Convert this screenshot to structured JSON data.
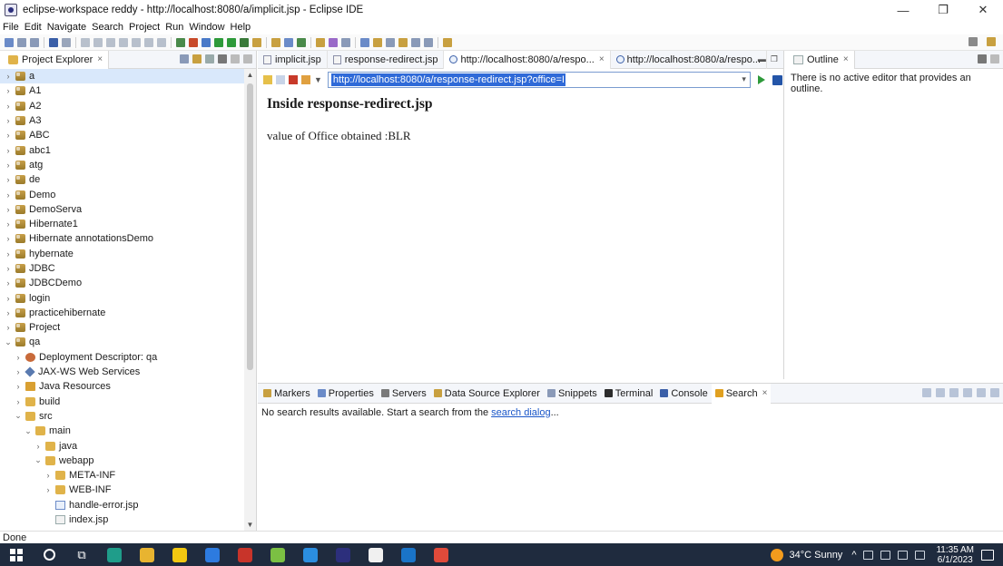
{
  "window": {
    "title": "eclipse-workspace reddy - http://localhost:8080/a/implicit.jsp - Eclipse IDE",
    "minimize": "—",
    "maximize": "❐",
    "close": "✕"
  },
  "menu": [
    "File",
    "Edit",
    "Navigate",
    "Search",
    "Project",
    "Run",
    "Window",
    "Help"
  ],
  "project_explorer": {
    "tab_label": "Project Explorer",
    "tree": [
      {
        "label": "a",
        "depth": 0,
        "expanded": false,
        "icon": "project",
        "selected": true
      },
      {
        "label": "A1",
        "depth": 0,
        "expanded": false,
        "icon": "project"
      },
      {
        "label": "A2",
        "depth": 0,
        "expanded": false,
        "icon": "project"
      },
      {
        "label": "A3",
        "depth": 0,
        "expanded": false,
        "icon": "project"
      },
      {
        "label": "ABC",
        "depth": 0,
        "expanded": false,
        "icon": "project"
      },
      {
        "label": "abc1",
        "depth": 0,
        "expanded": false,
        "icon": "project"
      },
      {
        "label": "atg",
        "depth": 0,
        "expanded": false,
        "icon": "project"
      },
      {
        "label": "de",
        "depth": 0,
        "expanded": false,
        "icon": "project"
      },
      {
        "label": "Demo",
        "depth": 0,
        "expanded": false,
        "icon": "project"
      },
      {
        "label": "DemoServa",
        "depth": 0,
        "expanded": false,
        "icon": "project"
      },
      {
        "label": "Hibernate1",
        "depth": 0,
        "expanded": false,
        "icon": "project"
      },
      {
        "label": "Hibernate annotationsDemo",
        "depth": 0,
        "expanded": false,
        "icon": "project"
      },
      {
        "label": "hybernate",
        "depth": 0,
        "expanded": false,
        "icon": "project"
      },
      {
        "label": "JDBC",
        "depth": 0,
        "expanded": false,
        "icon": "project"
      },
      {
        "label": "JDBCDemo",
        "depth": 0,
        "expanded": false,
        "icon": "project"
      },
      {
        "label": "login",
        "depth": 0,
        "expanded": false,
        "icon": "project"
      },
      {
        "label": "practicehibernate",
        "depth": 0,
        "expanded": false,
        "icon": "project"
      },
      {
        "label": "Project",
        "depth": 0,
        "expanded": false,
        "icon": "project"
      },
      {
        "label": "qa",
        "depth": 0,
        "expanded": true,
        "icon": "project"
      },
      {
        "label": "Deployment Descriptor: qa",
        "depth": 1,
        "expanded": false,
        "icon": "dd"
      },
      {
        "label": "JAX-WS Web Services",
        "depth": 1,
        "expanded": false,
        "icon": "ws"
      },
      {
        "label": "Java Resources",
        "depth": 1,
        "expanded": false,
        "icon": "jr"
      },
      {
        "label": "build",
        "depth": 1,
        "expanded": false,
        "icon": "folder"
      },
      {
        "label": "src",
        "depth": 1,
        "expanded": true,
        "icon": "folder"
      },
      {
        "label": "main",
        "depth": 2,
        "expanded": true,
        "icon": "folder"
      },
      {
        "label": "java",
        "depth": 3,
        "expanded": false,
        "icon": "folder"
      },
      {
        "label": "webapp",
        "depth": 3,
        "expanded": true,
        "icon": "folder"
      },
      {
        "label": "META-INF",
        "depth": 4,
        "expanded": false,
        "icon": "folder"
      },
      {
        "label": "WEB-INF",
        "depth": 4,
        "expanded": false,
        "icon": "folder"
      },
      {
        "label": "handle-error.jsp",
        "depth": 4,
        "expanded": null,
        "icon": "jsp"
      },
      {
        "label": "index.jsp",
        "depth": 4,
        "expanded": null,
        "icon": "file"
      }
    ]
  },
  "editor": {
    "tabs": [
      {
        "label": "implicit.jsp",
        "icon": "file",
        "active": false,
        "closable": false
      },
      {
        "label": "response-redirect.jsp",
        "icon": "file",
        "active": false,
        "closable": false
      },
      {
        "label": "http://localhost:8080/a/respo...",
        "icon": "globe",
        "active": true,
        "closable": true
      },
      {
        "label": "http://localhost:8080/a/respo...",
        "icon": "globe",
        "active": false,
        "closable": false
      }
    ],
    "url": "http://localhost:8080/a/response-redirect.jsp?office=BLR",
    "page_heading": "Inside response-redirect.jsp",
    "page_text": "value of Office obtained :BLR"
  },
  "outline": {
    "tab_label": "Outline",
    "message": "There is no active editor that provides an outline."
  },
  "bottom_panel": {
    "tabs": [
      {
        "label": "Markers",
        "color": "#c8a040"
      },
      {
        "label": "Properties",
        "color": "#6b8bc8"
      },
      {
        "label": "Servers",
        "color": "#7a7a7a"
      },
      {
        "label": "Data Source Explorer",
        "color": "#c8a040"
      },
      {
        "label": "Snippets",
        "color": "#8a9ab8"
      },
      {
        "label": "Terminal",
        "color": "#2c2c2c"
      },
      {
        "label": "Console",
        "color": "#3b5fa8"
      },
      {
        "label": "Search",
        "color": "#e0a020",
        "active": true
      }
    ],
    "message_prefix": "No search results available. Start a search from the ",
    "message_link": "search dialog",
    "message_suffix": "..."
  },
  "status": "Done",
  "taskbar": {
    "weather": "34°C  Sunny",
    "time": "11:35 AM",
    "date": "6/1/2023",
    "apps": [
      {
        "name": "edge-icon",
        "color": "#1f9d8a"
      },
      {
        "name": "file-explorer-icon",
        "color": "#e8b430"
      },
      {
        "name": "power-bi-icon",
        "color": "#f2c811"
      },
      {
        "name": "app-icon-blue",
        "color": "#2d7be0"
      },
      {
        "name": "visual-studio-icon",
        "color": "#c8342a"
      },
      {
        "name": "app-icon-green",
        "color": "#7bc043"
      },
      {
        "name": "app-icon-azure",
        "color": "#2b8ee0"
      },
      {
        "name": "eclipse-icon",
        "color": "#2c2f7c"
      },
      {
        "name": "notepad-icon",
        "color": "#f0f0f0"
      },
      {
        "name": "webex-icon",
        "color": "#1a74c8"
      },
      {
        "name": "chrome-icon",
        "color": "#e04a3a"
      }
    ]
  },
  "colors": {
    "selection": "#d9e8fb",
    "url_highlight": "#2f6ad8",
    "link": "#1a56c8",
    "taskbar": "#1f2b3e"
  }
}
